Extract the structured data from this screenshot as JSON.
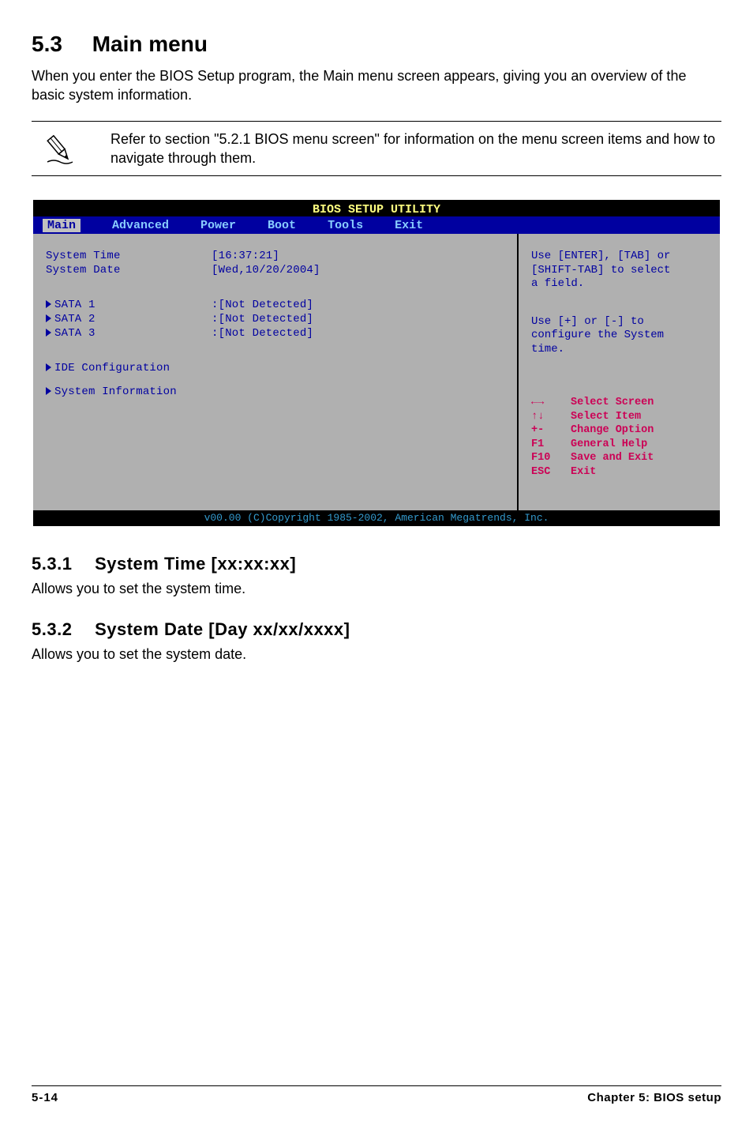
{
  "section": {
    "number": "5.3",
    "title": "Main menu",
    "intro": "When you enter the BIOS Setup program, the Main menu screen appears, giving you an overview of the basic system information.",
    "note": "Refer to section \"5.2.1  BIOS menu screen\" for information on the menu screen items and how to navigate through them."
  },
  "bios": {
    "header": "BIOS SETUP UTILITY",
    "tabs": [
      "Main",
      "Advanced",
      "Power",
      "Boot",
      "Tools",
      "Exit"
    ],
    "active_tab_index": 0,
    "left": {
      "system_time_label": "System Time",
      "system_time_value": "[16:37:21]",
      "system_date_label": "System Date",
      "system_date_value": "[Wed,10/20/2004]",
      "sata": [
        {
          "label": "SATA 1",
          "value": ":[Not Detected]"
        },
        {
          "label": "SATA 2",
          "value": ":[Not Detected]"
        },
        {
          "label": "SATA 3",
          "value": ":[Not Detected]"
        }
      ],
      "ide_config": "IDE Configuration",
      "sys_info": "System Information"
    },
    "right": {
      "help_top_1": "Use [ENTER], [TAB] or",
      "help_top_2": "[SHIFT-TAB] to select",
      "help_top_3": "a field.",
      "help_mid_1": "Use [+] or [-] to",
      "help_mid_2": "configure the System",
      "help_mid_3": "time.",
      "keys": [
        {
          "key": "←→",
          "label": "Select Screen"
        },
        {
          "key": "↑↓",
          "label": "Select Item"
        },
        {
          "key": "+-",
          "label": "Change Option"
        },
        {
          "key": "F1",
          "label": "General Help"
        },
        {
          "key": "F10",
          "label": "Save and Exit"
        },
        {
          "key": "ESC",
          "label": "Exit"
        }
      ]
    },
    "footer": "v00.00 (C)Copyright 1985-2002, American Megatrends, Inc."
  },
  "sub1": {
    "num": "5.3.1",
    "title": "System Time [xx:xx:xx]",
    "body": "Allows you to set the system time."
  },
  "sub2": {
    "num": "5.3.2",
    "title": "System Date [Day xx/xx/xxxx]",
    "body": "Allows you to set the system date."
  },
  "footer": {
    "page": "5-14",
    "chapter": "Chapter 5: BIOS setup"
  }
}
